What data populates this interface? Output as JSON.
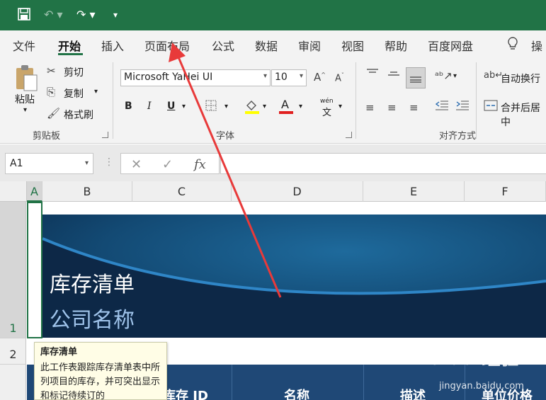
{
  "quick_access": {
    "save_icon": "save-icon",
    "undo_icon": "undo-icon",
    "redo_icon": "redo-icon",
    "customize_icon": "customize-qat-icon"
  },
  "ribbon_tabs": [
    {
      "label": "文件"
    },
    {
      "label": "开始",
      "active": true
    },
    {
      "label": "插入"
    },
    {
      "label": "页面布局"
    },
    {
      "label": "公式"
    },
    {
      "label": "数据"
    },
    {
      "label": "审阅"
    },
    {
      "label": "视图"
    },
    {
      "label": "帮助"
    },
    {
      "label": "百度网盘"
    },
    {
      "label": "操"
    }
  ],
  "clipboard": {
    "paste": "粘贴",
    "cut": "剪切",
    "copy": "复制",
    "format_painter": "格式刷",
    "group_label": "剪贴板"
  },
  "font": {
    "font_name": "Microsoft YaHei UI",
    "font_size": "10",
    "bold": "B",
    "italic": "I",
    "underline": "U",
    "font_color_letter": "A",
    "phonetic": "wén",
    "group_label": "字体",
    "fill_color": "#ffff00",
    "text_color": "#e02020"
  },
  "alignment": {
    "wrap_text": "自动换行",
    "merge_center": "合并后居中",
    "group_label": "对齐方式"
  },
  "formula_bar": {
    "name_box": "A1",
    "cancel": "✕",
    "enter": "✓",
    "fx": "fx",
    "formula": ""
  },
  "columns": [
    "A",
    "B",
    "C",
    "D",
    "E",
    "F"
  ],
  "rows": [
    "1",
    "2"
  ],
  "banner": {
    "title": "库存清单",
    "subtitle": "公司名称"
  },
  "table_headers": [
    "库存 ID",
    "名称",
    "描述",
    "单位价格"
  ],
  "tooltip": {
    "title": "库存清单",
    "body": "此工作表跟踪库存清单表中所列项目的库存，并可突出显示和标记待续订的"
  },
  "watermark": {
    "brand": "Baidu 经验",
    "url": "jingyan.baidu.com"
  },
  "colors": {
    "excel_green": "#217346",
    "table_header_blue": "#1f4876",
    "banner_navy": "#0e2a4a",
    "annotation_red": "#e83a3a"
  }
}
